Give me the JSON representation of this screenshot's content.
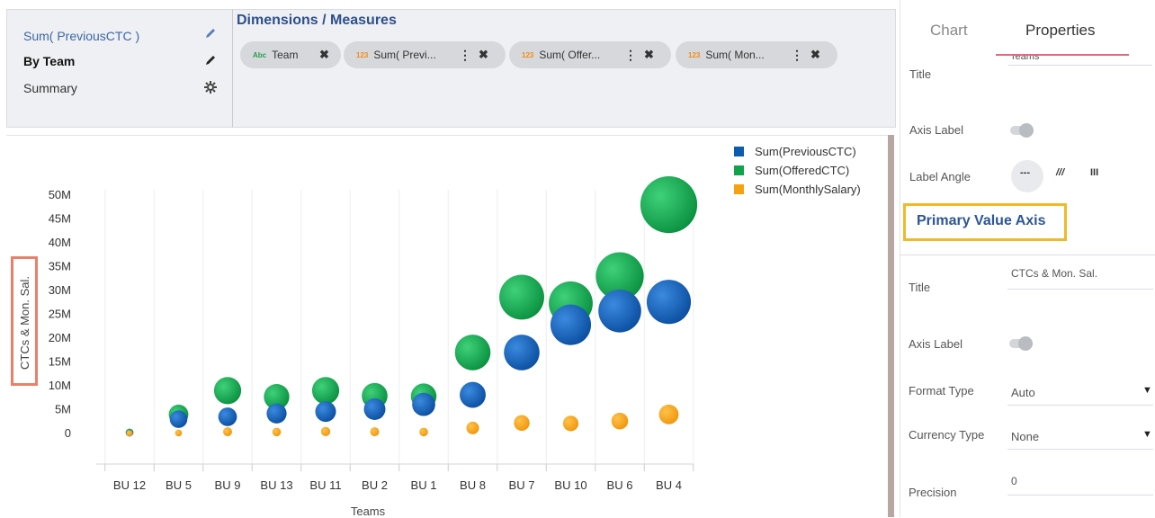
{
  "left_panel": {
    "items": [
      {
        "label": "Sum( PreviousCTC )",
        "icon": "pencil-icon"
      },
      {
        "label": "By Team",
        "icon": "pencil-icon"
      },
      {
        "label": "Summary",
        "icon": "gear-icon"
      }
    ]
  },
  "dims": {
    "title": "Dimensions / Measures",
    "pills": [
      {
        "tag": "Abc",
        "label": "Team"
      },
      {
        "tag": "123",
        "label": "Sum( Previ..."
      },
      {
        "tag": "123",
        "label": "Sum( Offer..."
      },
      {
        "tag": "123",
        "label": "Sum( Mon..."
      }
    ]
  },
  "right_panel": {
    "tabs": [
      "Chart",
      "Properties"
    ],
    "title_label": "Title",
    "title_value_partial": "Teams",
    "axis_label": "Axis Label",
    "label_angle": "Label Angle",
    "angle_options": [
      "---",
      "///",
      "III"
    ],
    "primary_value_axis": "Primary Value Axis",
    "pva_title_label": "Title",
    "pva_title_value": "CTCs & Mon. Sal.",
    "pva_axis_label": "Axis Label",
    "format_type_label": "Format Type",
    "format_type_value": "Auto",
    "currency_type_label": "Currency Type",
    "currency_type_value": "None",
    "precision_label": "Precision",
    "precision_value": "0"
  },
  "colors": {
    "previous": "#0b5cad",
    "offered": "#11a24a",
    "monthly": "#f5a20f"
  },
  "chart_data": {
    "type": "scatter",
    "xlabel": "Teams",
    "ylabel": "CTCs & Mon. Sal.",
    "categories": [
      "BU 12",
      "BU 5",
      "BU 9",
      "BU 13",
      "BU 11",
      "BU 2",
      "BU 1",
      "BU 8",
      "BU 7",
      "BU 10",
      "BU 6",
      "BU 4"
    ],
    "y_ticks": [
      "0",
      "5M",
      "10M",
      "15M",
      "20M",
      "25M",
      "30M",
      "35M",
      "40M",
      "45M",
      "50M"
    ],
    "ylim": [
      0,
      50000000
    ],
    "series": [
      {
        "name": "Sum(PreviousCTC)",
        "values": [
          100000,
          3000000,
          3500000,
          4200000,
          4600000,
          5100000,
          6100000,
          8100000,
          17000000,
          22800000,
          25700000,
          27600000
        ]
      },
      {
        "name": "Sum(OfferedCTC)",
        "values": [
          200000,
          4000000,
          9000000,
          7700000,
          9000000,
          7900000,
          7800000,
          17000000,
          28600000,
          27300000,
          33000000,
          48000000
        ]
      },
      {
        "name": "Sum(MonthlySalary)",
        "values": [
          50000,
          100000,
          350000,
          300000,
          400000,
          350000,
          300000,
          1150000,
          2200000,
          2100000,
          2600000,
          4000000
        ]
      }
    ],
    "legend_position": "top-right",
    "grid": true
  }
}
